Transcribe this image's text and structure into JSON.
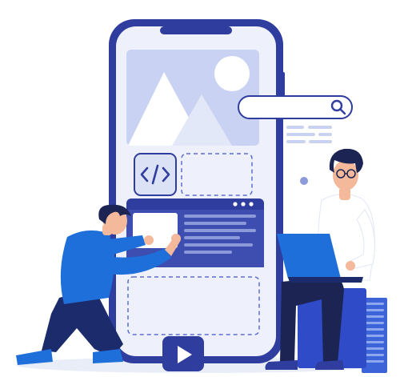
{
  "illustration": {
    "subject": "app-development",
    "icons": [
      "image-placeholder-icon",
      "code-icon",
      "search-icon",
      "play-icon"
    ]
  },
  "colors": {
    "primary": "#1E6FD9",
    "navy": "#1B2B6B",
    "phone_frame": "#2F3D9E",
    "screen_bg": "#EEF1FB",
    "panel_light": "#C9D2F2",
    "text_line": "#8C9AD9",
    "skin": "#F4B99A",
    "hair": "#1B2452",
    "shirt_white": "#FFFFFF"
  }
}
